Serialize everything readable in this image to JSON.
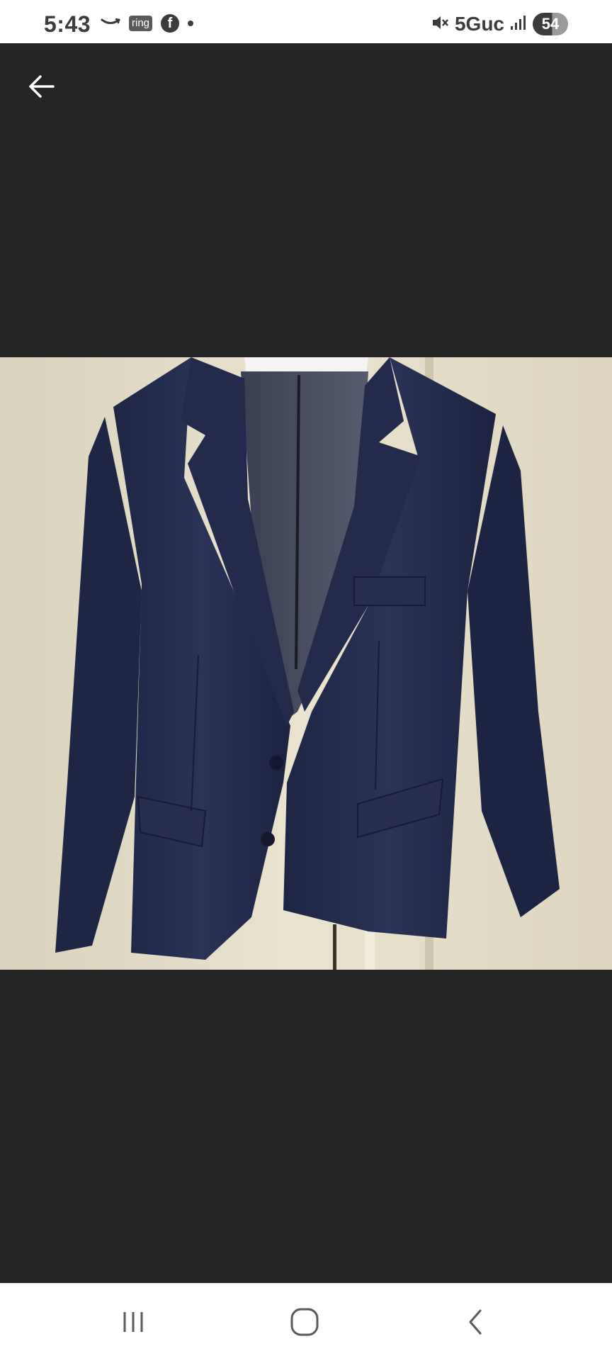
{
  "status_bar": {
    "time": "5:43",
    "ring_label": "ring",
    "facebook_letter": "f",
    "network_label": "5Guc",
    "battery_level": "54"
  },
  "viewer": {
    "background_color": "#242424",
    "photo_subject": "navy blazer on hanger"
  },
  "icons": {
    "back": "arrow-left-icon",
    "recents": "recents-icon",
    "home": "home-icon",
    "nav_back": "chevron-left-icon",
    "mute": "muted-speaker-icon",
    "signal": "signal-bars-icon",
    "amazon": "amazon-smile-icon"
  }
}
